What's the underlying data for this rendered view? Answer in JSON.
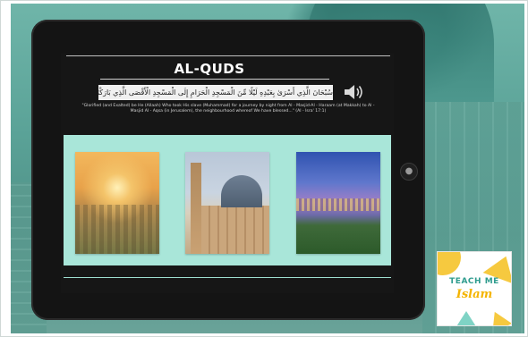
{
  "lesson": {
    "title": "AL-QUDS",
    "arabic_verse": "سُبْحَانَ الَّذِي أَسْرَىٰ بِعَبْدِهِ لَيْلًا مِّنَ الْمَسْجِدِ الْحَرَامِ إِلَى الْمَسْجِدِ الْأَقْصَى الَّذِي بَارَكْنَا حَوْلَهُ",
    "translation": "\"Glorified (and Exalted) be He (Allaah) Who took His slave (Muhammad) for a journey by night from Al - Masjid-Al - Haraam (at Makkah) to Al - Masjid Al - Aqsa (in Jerusalem), the neighbourhood whereof We have blessed...\" (Al - Isra' 17:1)",
    "audio_icon": "speaker-icon",
    "photos": [
      {
        "subject": "jerusalem-sunrise"
      },
      {
        "subject": "al-aqsa-mosque-dome"
      },
      {
        "subject": "jerusalem-city-at-dusk"
      }
    ]
  },
  "device": {
    "home_button_icon": "home-button-icon"
  },
  "logo": {
    "line1": "TEACH ME",
    "line2": "Islam"
  },
  "colors": {
    "background": "#5aa297",
    "tablet": "#141414",
    "panel": "#a9e6d9",
    "logo_teal": "#2f9c8e",
    "logo_yellow": "#f6c93f"
  }
}
